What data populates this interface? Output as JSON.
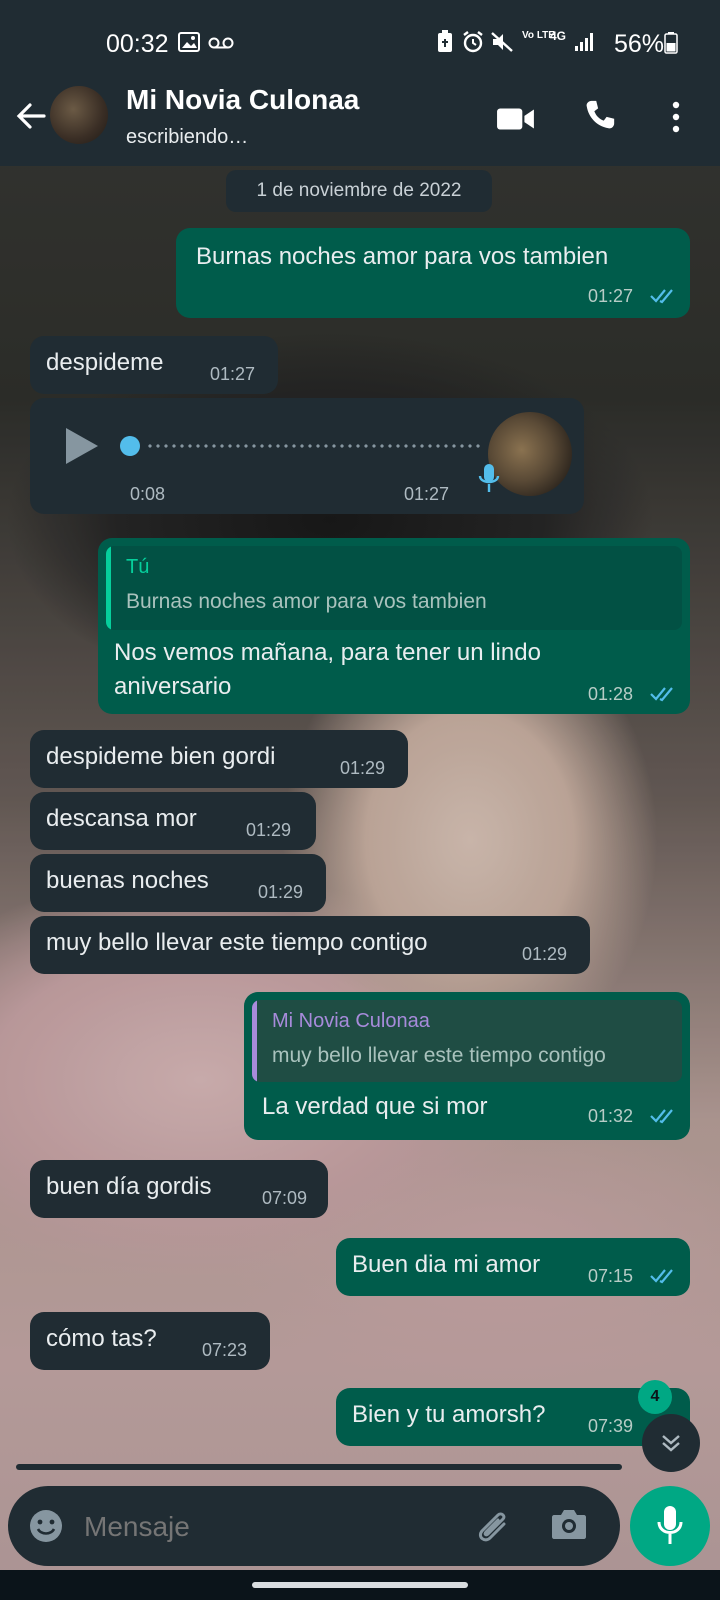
{
  "status_bar": {
    "time": "00:32",
    "battery": "56%",
    "icons": [
      "gallery-icon",
      "voicemail-icon",
      "battery-saver-icon",
      "alarm-icon",
      "mute-icon",
      "volte-icon",
      "4g-icon",
      "signal-icon",
      "battery-icon"
    ],
    "network_labels": [
      "Vo LTE",
      "4G"
    ]
  },
  "header": {
    "contact_name": "Mi Novia Culonaa",
    "status": "escribiendo…",
    "icons": [
      "back-arrow-icon",
      "video-call-icon",
      "phone-icon",
      "more-vert-icon"
    ]
  },
  "date_chip": "1 de noviembre de 2022",
  "messages": [
    {
      "dir": "out",
      "text": "Burnas noches amor para vos tambien",
      "time": "01:27",
      "read": true
    },
    {
      "dir": "in",
      "text": "despideme",
      "time": "01:27"
    },
    {
      "dir": "in",
      "type": "voice",
      "duration": "0:08",
      "time": "01:27",
      "progress": 0
    },
    {
      "dir": "out",
      "quote_author": "Tú",
      "quote_text": "Burnas noches amor para vos tambien",
      "text_lines": [
        "Nos vemos mañana,  para tener un lindo",
        "aniversario"
      ],
      "time": "01:28",
      "read": true
    },
    {
      "dir": "in",
      "text": "despideme bien gordi",
      "time": "01:29"
    },
    {
      "dir": "in",
      "text": "descansa mor",
      "time": "01:29"
    },
    {
      "dir": "in",
      "text": "buenas noches",
      "time": "01:29"
    },
    {
      "dir": "in",
      "text": "muy bello llevar este tiempo contigo",
      "time": "01:29"
    },
    {
      "dir": "out",
      "quote_author": "Mi Novia Culonaa",
      "quote_text": "muy bello llevar este tiempo contigo",
      "text": "La verdad que si mor",
      "time": "01:32",
      "read": true
    },
    {
      "dir": "in",
      "text": "buen día gordis",
      "time": "07:09"
    },
    {
      "dir": "out",
      "text": "Buen dia mi amor",
      "time": "07:15",
      "read": true
    },
    {
      "dir": "in",
      "text": "cómo tas?",
      "time": "07:23"
    },
    {
      "dir": "out",
      "text": "Bien y tu amorsh?",
      "time": "07:39",
      "read": false
    }
  ],
  "unread_count": "4",
  "input": {
    "placeholder": "Mensaje"
  },
  "colors": {
    "outgoing": "#005c4b",
    "incoming": "#202c33",
    "accent": "#00a884",
    "read_ticks": "#53bdeb",
    "quote_you": "#06cf9c",
    "quote_contact": "#a78bdb"
  }
}
